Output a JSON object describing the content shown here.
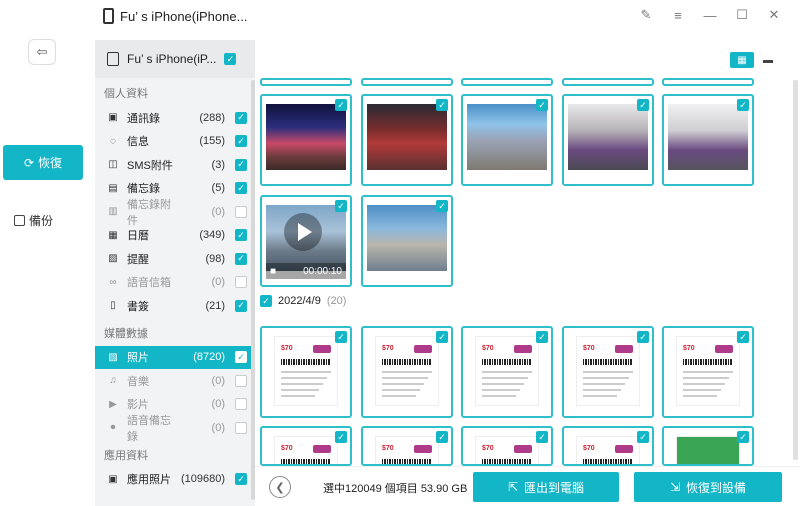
{
  "window": {
    "title": "Fu’ s iPhone(iPhone..."
  },
  "nav": {
    "restore_label": "恢復",
    "backup_label": "備份"
  },
  "device": {
    "name": "Fu’ s iPhone(iP..."
  },
  "sections": {
    "personal": "個人資料",
    "media": "媒體數據",
    "apps": "應用資料"
  },
  "categories": [
    {
      "label": "通訊錄",
      "count": "(288)",
      "icon": "contacts-icon",
      "checked": true
    },
    {
      "label": "信息",
      "count": "(155)",
      "icon": "message-icon",
      "checked": true
    },
    {
      "label": "SMS附件",
      "count": "(3)",
      "icon": "attachment-icon",
      "checked": true
    },
    {
      "label": "備忘錄",
      "count": "(5)",
      "icon": "notes-icon",
      "checked": true
    },
    {
      "label": "備忘錄附件",
      "count": "(0)",
      "icon": "notes-attachment-icon",
      "checked": false
    },
    {
      "label": "日曆",
      "count": "(349)",
      "icon": "calendar-icon",
      "checked": true
    },
    {
      "label": "提醒",
      "count": "(98)",
      "icon": "reminder-icon",
      "checked": true
    },
    {
      "label": "語音信箱",
      "count": "(0)",
      "icon": "voicemail-icon",
      "checked": false
    },
    {
      "label": "書簽",
      "count": "(21)",
      "icon": "bookmark-icon",
      "checked": true
    }
  ],
  "media_categories": [
    {
      "label": "照片",
      "count": "(8720)",
      "icon": "photo-icon",
      "checked": true
    },
    {
      "label": "音樂",
      "count": "(0)",
      "icon": "music-icon",
      "checked": false
    },
    {
      "label": "影片",
      "count": "(0)",
      "icon": "video-icon",
      "checked": false
    },
    {
      "label": "語音備忘錄",
      "count": "(0)",
      "icon": "mic-icon",
      "checked": false
    }
  ],
  "app_categories": [
    {
      "label": "應用照片",
      "count": "(109680)",
      "icon": "app-photo-icon",
      "checked": true
    }
  ],
  "gallery": {
    "video_duration": "00:00:10",
    "date_group": "2022/4/9",
    "date_count": "(20)",
    "receipt_price": "$70"
  },
  "footer": {
    "selection_info": "選中120049 個項目 53.90 GB",
    "export_label": "匯出到電腦",
    "restore_label": "恢復到設備"
  },
  "colors": {
    "accent": "#13b6c6"
  }
}
